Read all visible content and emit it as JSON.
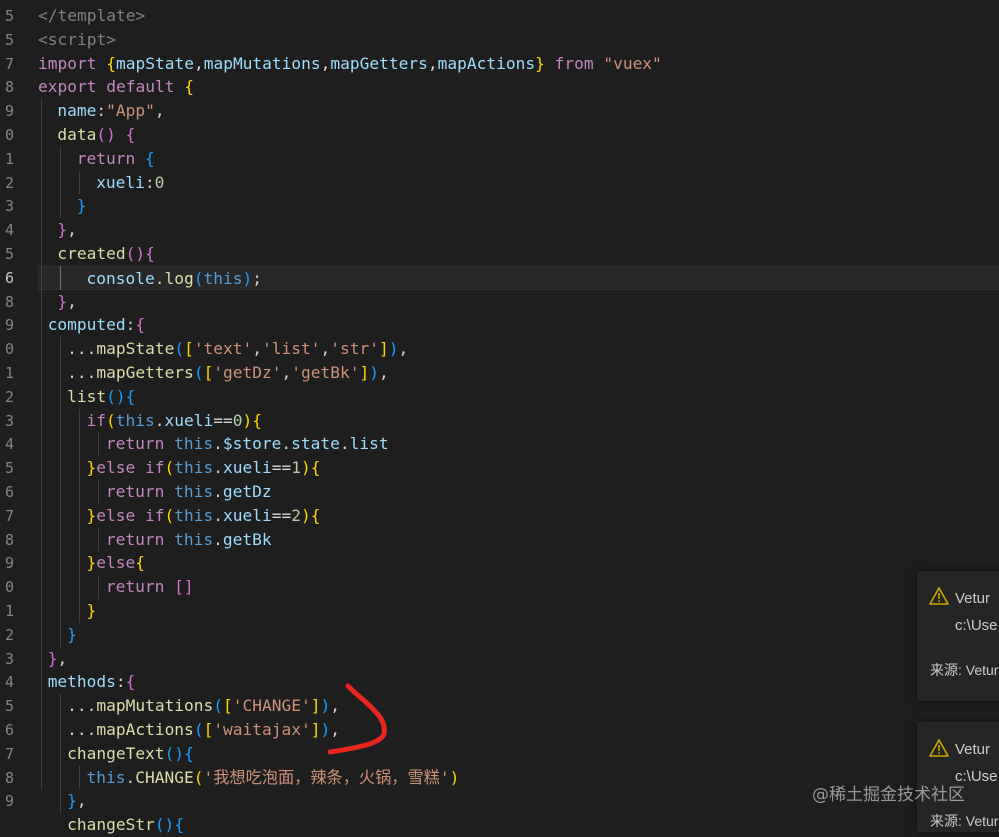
{
  "theme": {
    "background": "#1e1e1e",
    "default_text": "#d4d4d4",
    "keyword": "#c586c0",
    "storage": "#569cd6",
    "variable": "#9cdcfe",
    "function": "#dcdcaa",
    "string": "#ce9178",
    "number": "#b5cea8",
    "tag_gray": "#808080",
    "bracket_gold": "#ffd700",
    "bracket_purple": "#da70d6",
    "bracket_blue": "#179fff",
    "annotation_red": "#e8261f"
  },
  "gutter": {
    "line_numbers": [
      "5",
      "5",
      "7",
      "8",
      "9",
      "0",
      "1",
      "2",
      "3",
      "4",
      "5",
      "6",
      "8",
      "9",
      "0",
      "1",
      "2",
      "3",
      "4",
      "5",
      "6",
      "7",
      "8",
      "9",
      "0",
      "1",
      "2",
      "3",
      "4",
      "5",
      "6",
      "7",
      "8",
      "9"
    ]
  },
  "code_lines": [
    {
      "indent": 0,
      "tokens": [
        {
          "t": "</template>",
          "c": "tag_gray"
        }
      ]
    },
    {
      "indent": 0,
      "tokens": [
        {
          "t": "<script>",
          "c": "tag_gray"
        }
      ]
    },
    {
      "indent": 0,
      "tokens": [
        {
          "t": "import ",
          "c": "keyword"
        },
        {
          "t": "{",
          "c": "bracket_gold"
        },
        {
          "t": "mapState",
          "c": "variable"
        },
        {
          "t": ",",
          "c": "default_text"
        },
        {
          "t": "mapMutations",
          "c": "variable"
        },
        {
          "t": ",",
          "c": "default_text"
        },
        {
          "t": "mapGetters",
          "c": "variable"
        },
        {
          "t": ",",
          "c": "default_text"
        },
        {
          "t": "mapActions",
          "c": "variable"
        },
        {
          "t": "}",
          "c": "bracket_gold"
        },
        {
          "t": " from ",
          "c": "keyword"
        },
        {
          "t": "\"vuex\"",
          "c": "string"
        }
      ]
    },
    {
      "indent": 0,
      "tokens": [
        {
          "t": "export ",
          "c": "keyword"
        },
        {
          "t": "default ",
          "c": "keyword"
        },
        {
          "t": "{",
          "c": "bracket_gold"
        }
      ]
    },
    {
      "indent": 1,
      "tokens": [
        {
          "t": "name",
          "c": "variable"
        },
        {
          "t": ":",
          "c": "default_text"
        },
        {
          "t": "\"App\"",
          "c": "string"
        },
        {
          "t": ",",
          "c": "default_text"
        }
      ]
    },
    {
      "indent": 1,
      "tokens": [
        {
          "t": "data",
          "c": "function"
        },
        {
          "t": "()",
          "c": "bracket_purple"
        },
        {
          "t": " ",
          "c": "default_text"
        },
        {
          "t": "{",
          "c": "bracket_purple"
        }
      ]
    },
    {
      "indent": 2,
      "tokens": [
        {
          "t": "return ",
          "c": "keyword"
        },
        {
          "t": "{",
          "c": "bracket_blue"
        }
      ]
    },
    {
      "indent": 3,
      "tokens": [
        {
          "t": "xueli",
          "c": "variable"
        },
        {
          "t": ":",
          "c": "default_text"
        },
        {
          "t": "0",
          "c": "number"
        }
      ]
    },
    {
      "indent": 2,
      "tokens": [
        {
          "t": "}",
          "c": "bracket_blue"
        }
      ]
    },
    {
      "indent": 1,
      "tokens": [
        {
          "t": "}",
          "c": "bracket_purple"
        },
        {
          "t": ",",
          "c": "default_text"
        }
      ]
    },
    {
      "indent": 1,
      "tokens": [
        {
          "t": "created",
          "c": "function"
        },
        {
          "t": "()",
          "c": "bracket_purple"
        },
        {
          "t": "{",
          "c": "bracket_purple"
        }
      ]
    },
    {
      "indent": 2.5,
      "current": true,
      "tokens": [
        {
          "t": "console",
          "c": "variable"
        },
        {
          "t": ".",
          "c": "default_text"
        },
        {
          "t": "log",
          "c": "function"
        },
        {
          "t": "(",
          "c": "bracket_blue"
        },
        {
          "t": "this",
          "c": "storage"
        },
        {
          "t": ")",
          "c": "bracket_blue"
        },
        {
          "t": ";",
          "c": "default_text"
        }
      ]
    },
    {
      "indent": 1,
      "tokens": [
        {
          "t": "}",
          "c": "bracket_purple"
        },
        {
          "t": ",",
          "c": "default_text"
        }
      ]
    },
    {
      "indent": 0.5,
      "tokens": [
        {
          "t": "computed",
          "c": "variable"
        },
        {
          "t": ":",
          "c": "default_text"
        },
        {
          "t": "{",
          "c": "bracket_purple"
        }
      ]
    },
    {
      "indent": 1.5,
      "tokens": [
        {
          "t": "...",
          "c": "default_text"
        },
        {
          "t": "mapState",
          "c": "function"
        },
        {
          "t": "(",
          "c": "bracket_blue"
        },
        {
          "t": "[",
          "c": "bracket_gold"
        },
        {
          "t": "'text'",
          "c": "string"
        },
        {
          "t": ",",
          "c": "default_text"
        },
        {
          "t": "'list'",
          "c": "string"
        },
        {
          "t": ",",
          "c": "default_text"
        },
        {
          "t": "'str'",
          "c": "string"
        },
        {
          "t": "]",
          "c": "bracket_gold"
        },
        {
          "t": ")",
          "c": "bracket_blue"
        },
        {
          "t": ",",
          "c": "default_text"
        }
      ]
    },
    {
      "indent": 1.5,
      "tokens": [
        {
          "t": "...",
          "c": "default_text"
        },
        {
          "t": "mapGetters",
          "c": "function"
        },
        {
          "t": "(",
          "c": "bracket_blue"
        },
        {
          "t": "[",
          "c": "bracket_gold"
        },
        {
          "t": "'getDz'",
          "c": "string"
        },
        {
          "t": ",",
          "c": "default_text"
        },
        {
          "t": "'getBk'",
          "c": "string"
        },
        {
          "t": "]",
          "c": "bracket_gold"
        },
        {
          "t": ")",
          "c": "bracket_blue"
        },
        {
          "t": ",",
          "c": "default_text"
        }
      ]
    },
    {
      "indent": 1.5,
      "tokens": [
        {
          "t": "list",
          "c": "function"
        },
        {
          "t": "()",
          "c": "bracket_blue"
        },
        {
          "t": "{",
          "c": "bracket_blue"
        }
      ]
    },
    {
      "indent": 2.5,
      "tokens": [
        {
          "t": "if",
          "c": "keyword"
        },
        {
          "t": "(",
          "c": "bracket_gold"
        },
        {
          "t": "this",
          "c": "storage"
        },
        {
          "t": ".",
          "c": "default_text"
        },
        {
          "t": "xueli",
          "c": "variable"
        },
        {
          "t": "==",
          "c": "default_text"
        },
        {
          "t": "0",
          "c": "number"
        },
        {
          "t": ")",
          "c": "bracket_gold"
        },
        {
          "t": "{",
          "c": "bracket_gold"
        }
      ]
    },
    {
      "indent": 3.5,
      "tokens": [
        {
          "t": "return ",
          "c": "keyword"
        },
        {
          "t": "this",
          "c": "storage"
        },
        {
          "t": ".",
          "c": "default_text"
        },
        {
          "t": "$store",
          "c": "variable"
        },
        {
          "t": ".",
          "c": "default_text"
        },
        {
          "t": "state",
          "c": "variable"
        },
        {
          "t": ".",
          "c": "default_text"
        },
        {
          "t": "list",
          "c": "variable"
        }
      ]
    },
    {
      "indent": 2.5,
      "tokens": [
        {
          "t": "}",
          "c": "bracket_gold"
        },
        {
          "t": "else ",
          "c": "keyword"
        },
        {
          "t": "if",
          "c": "keyword"
        },
        {
          "t": "(",
          "c": "bracket_gold"
        },
        {
          "t": "this",
          "c": "storage"
        },
        {
          "t": ".",
          "c": "default_text"
        },
        {
          "t": "xueli",
          "c": "variable"
        },
        {
          "t": "==",
          "c": "default_text"
        },
        {
          "t": "1",
          "c": "number"
        },
        {
          "t": ")",
          "c": "bracket_gold"
        },
        {
          "t": "{",
          "c": "bracket_gold"
        }
      ]
    },
    {
      "indent": 3.5,
      "tokens": [
        {
          "t": "return ",
          "c": "keyword"
        },
        {
          "t": "this",
          "c": "storage"
        },
        {
          "t": ".",
          "c": "default_text"
        },
        {
          "t": "getDz",
          "c": "variable"
        }
      ]
    },
    {
      "indent": 2.5,
      "tokens": [
        {
          "t": "}",
          "c": "bracket_gold"
        },
        {
          "t": "else ",
          "c": "keyword"
        },
        {
          "t": "if",
          "c": "keyword"
        },
        {
          "t": "(",
          "c": "bracket_gold"
        },
        {
          "t": "this",
          "c": "storage"
        },
        {
          "t": ".",
          "c": "default_text"
        },
        {
          "t": "xueli",
          "c": "variable"
        },
        {
          "t": "==",
          "c": "default_text"
        },
        {
          "t": "2",
          "c": "number"
        },
        {
          "t": ")",
          "c": "bracket_gold"
        },
        {
          "t": "{",
          "c": "bracket_gold"
        }
      ]
    },
    {
      "indent": 3.5,
      "tokens": [
        {
          "t": "return ",
          "c": "keyword"
        },
        {
          "t": "this",
          "c": "storage"
        },
        {
          "t": ".",
          "c": "default_text"
        },
        {
          "t": "getBk",
          "c": "variable"
        }
      ]
    },
    {
      "indent": 2.5,
      "tokens": [
        {
          "t": "}",
          "c": "bracket_gold"
        },
        {
          "t": "else",
          "c": "keyword"
        },
        {
          "t": "{",
          "c": "bracket_gold"
        }
      ]
    },
    {
      "indent": 3.5,
      "tokens": [
        {
          "t": "return ",
          "c": "keyword"
        },
        {
          "t": "[]",
          "c": "bracket_purple"
        }
      ]
    },
    {
      "indent": 2.5,
      "tokens": [
        {
          "t": "}",
          "c": "bracket_gold"
        }
      ]
    },
    {
      "indent": 1.5,
      "tokens": [
        {
          "t": "}",
          "c": "bracket_blue"
        }
      ]
    },
    {
      "indent": 0.5,
      "tokens": [
        {
          "t": "}",
          "c": "bracket_purple"
        },
        {
          "t": ",",
          "c": "default_text"
        }
      ]
    },
    {
      "indent": 0.5,
      "tokens": [
        {
          "t": "methods",
          "c": "variable"
        },
        {
          "t": ":",
          "c": "default_text"
        },
        {
          "t": "{",
          "c": "bracket_purple"
        }
      ]
    },
    {
      "indent": 1.5,
      "tokens": [
        {
          "t": "...",
          "c": "default_text"
        },
        {
          "t": "mapMutations",
          "c": "function"
        },
        {
          "t": "(",
          "c": "bracket_blue"
        },
        {
          "t": "[",
          "c": "bracket_gold"
        },
        {
          "t": "'CHANGE'",
          "c": "string"
        },
        {
          "t": "]",
          "c": "bracket_gold"
        },
        {
          "t": ")",
          "c": "bracket_blue"
        },
        {
          "t": ",",
          "c": "default_text"
        }
      ]
    },
    {
      "indent": 1.5,
      "tokens": [
        {
          "t": "...",
          "c": "default_text"
        },
        {
          "t": "mapActions",
          "c": "function"
        },
        {
          "t": "(",
          "c": "bracket_blue"
        },
        {
          "t": "[",
          "c": "bracket_gold"
        },
        {
          "t": "'waitajax'",
          "c": "string"
        },
        {
          "t": "]",
          "c": "bracket_gold"
        },
        {
          "t": ")",
          "c": "bracket_blue"
        },
        {
          "t": ",",
          "c": "default_text"
        }
      ]
    },
    {
      "indent": 1.5,
      "tokens": [
        {
          "t": "changeText",
          "c": "function"
        },
        {
          "t": "()",
          "c": "bracket_blue"
        },
        {
          "t": "{",
          "c": "bracket_blue"
        }
      ]
    },
    {
      "indent": 2.5,
      "tokens": [
        {
          "t": "this",
          "c": "storage"
        },
        {
          "t": ".",
          "c": "default_text"
        },
        {
          "t": "CHANGE",
          "c": "function"
        },
        {
          "t": "(",
          "c": "bracket_gold"
        },
        {
          "t": "'我想吃泡面，辣条，火锅，雪糕'",
          "c": "string"
        },
        {
          "t": ")",
          "c": "bracket_gold"
        }
      ]
    },
    {
      "indent": 1.5,
      "tokens": [
        {
          "t": "}",
          "c": "bracket_blue"
        },
        {
          "t": ",",
          "c": "default_text"
        }
      ]
    },
    {
      "indent": 1.5,
      "tokens": [
        {
          "t": "changeStr",
          "c": "function"
        },
        {
          "t": "()",
          "c": "bracket_blue"
        },
        {
          "t": "{",
          "c": "bracket_blue"
        }
      ]
    }
  ],
  "notifications": [
    {
      "title": "Vetur",
      "path": "c:\\Use",
      "source": "来源: Vetur"
    },
    {
      "title": "Vetur",
      "path": "c:\\Use",
      "source": "来源: Vetur"
    }
  ],
  "watermark": "@稀土掘金技术社区",
  "icons": {
    "warning": "warning-icon"
  }
}
